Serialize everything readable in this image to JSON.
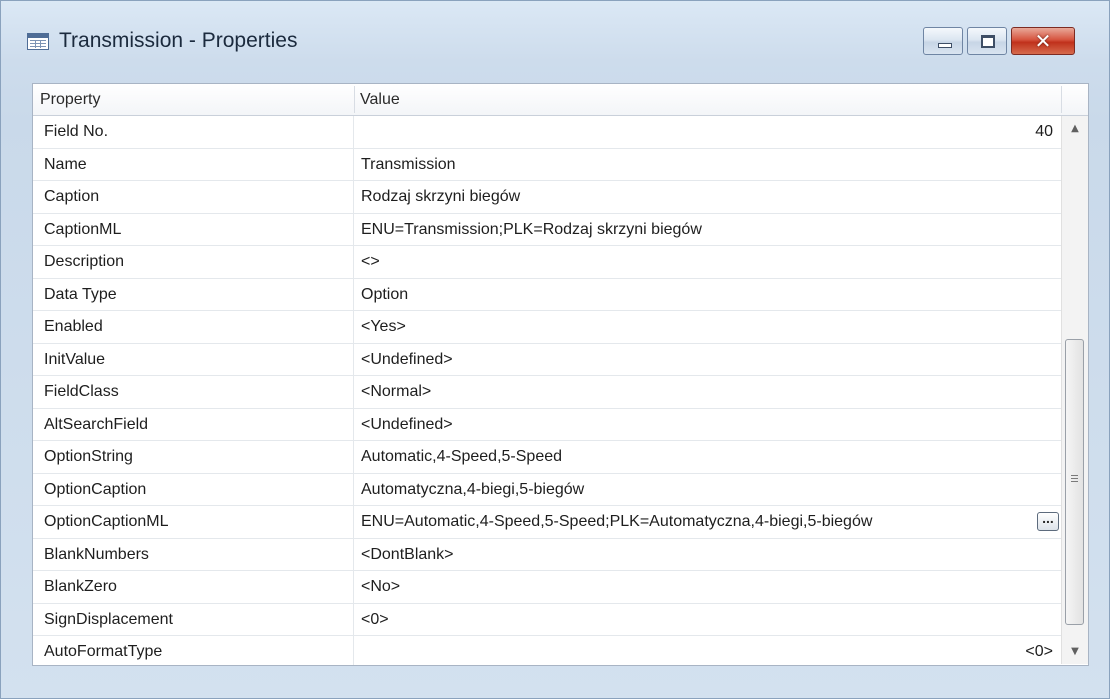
{
  "window": {
    "title": "Transmission - Properties",
    "title_icon": "table-icon",
    "controls": [
      "minimize-icon",
      "maximize-icon",
      "close-icon"
    ],
    "close_glyph": "✕"
  },
  "grid": {
    "header": {
      "property": "Property",
      "value": "Value"
    },
    "rows": [
      {
        "property": "Field No.",
        "value": "40",
        "align": "right"
      },
      {
        "property": "Name",
        "value": "Transmission"
      },
      {
        "property": "Caption",
        "value": "Rodzaj skrzyni biegów"
      },
      {
        "property": "CaptionML",
        "value": "ENU=Transmission;PLK=Rodzaj skrzyni biegów"
      },
      {
        "property": "Description",
        "value": "<>"
      },
      {
        "property": "Data Type",
        "value": "Option"
      },
      {
        "property": "Enabled",
        "value": "<Yes>"
      },
      {
        "property": "InitValue",
        "value": "<Undefined>"
      },
      {
        "property": "FieldClass",
        "value": "<Normal>"
      },
      {
        "property": "AltSearchField",
        "value": "<Undefined>"
      },
      {
        "property": "OptionString",
        "value": "Automatic,4-Speed,5-Speed"
      },
      {
        "property": "OptionCaption",
        "value": "Automatyczna,4-biegi,5-biegów"
      },
      {
        "property": "OptionCaptionML",
        "value": "ENU=Automatic,4-Speed,5-Speed;PLK=Automatyczna,4-biegi,5-biegów",
        "assist_button": "..."
      },
      {
        "property": "BlankNumbers",
        "value": "<DontBlank>"
      },
      {
        "property": "BlankZero",
        "value": "<No>"
      },
      {
        "property": "SignDisplacement",
        "value": "<0>"
      },
      {
        "property": "AutoFormatType",
        "value": "<0>",
        "align": "right"
      }
    ]
  },
  "scrollbar": {
    "up_glyph": "▲",
    "down_glyph": "▼"
  },
  "colors": {
    "window_frame": "#cddcec",
    "close_button": "#c0311c",
    "grid_background": "#ffffff"
  }
}
